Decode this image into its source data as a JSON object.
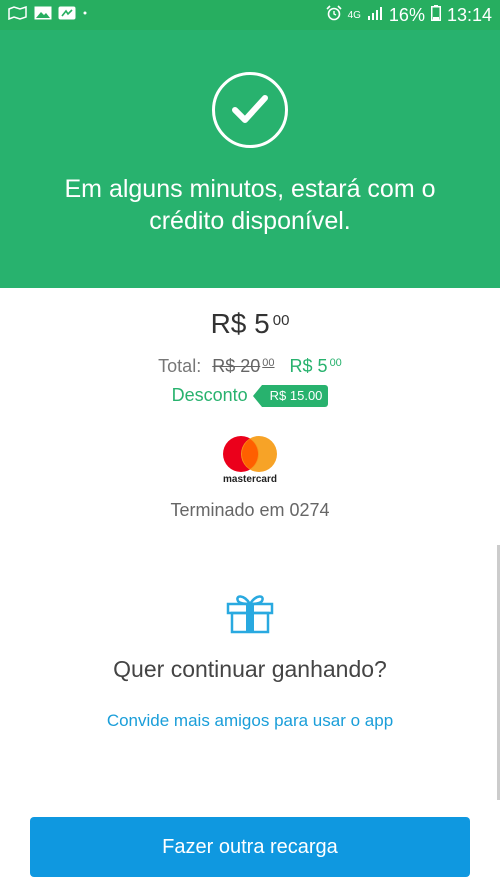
{
  "status_bar": {
    "network": "4G",
    "battery": "16%",
    "time": "13:14",
    "icons": [
      "maps-icon",
      "gallery-icon",
      "fb-messenger-icon",
      "notification-dot-icon",
      "alarm-icon",
      "signal-icon",
      "battery-icon"
    ]
  },
  "header": {
    "icon": "check-circle-icon",
    "message": "Em alguns minutos, estará com o crédito disponível.",
    "background": "#28b26e"
  },
  "summary": {
    "amount_main": "R$ 5",
    "amount_cents": "00",
    "total_label": "Total:",
    "old_price_main": "R$ 20",
    "old_price_cents": "00",
    "new_price_main": "R$ 5",
    "new_price_cents": "00",
    "discount_label": "Desconto",
    "discount_value": "R$ 15.00"
  },
  "payment": {
    "card_brand": "mastercard",
    "card_ending": "Terminado em 0274"
  },
  "promo": {
    "icon": "gift-icon",
    "title": "Quer continuar ganhando?",
    "invite_link": "Convide mais amigos para usar o app"
  },
  "action": {
    "button_label": "Fazer outra recarga",
    "color": "#0f98e0"
  }
}
